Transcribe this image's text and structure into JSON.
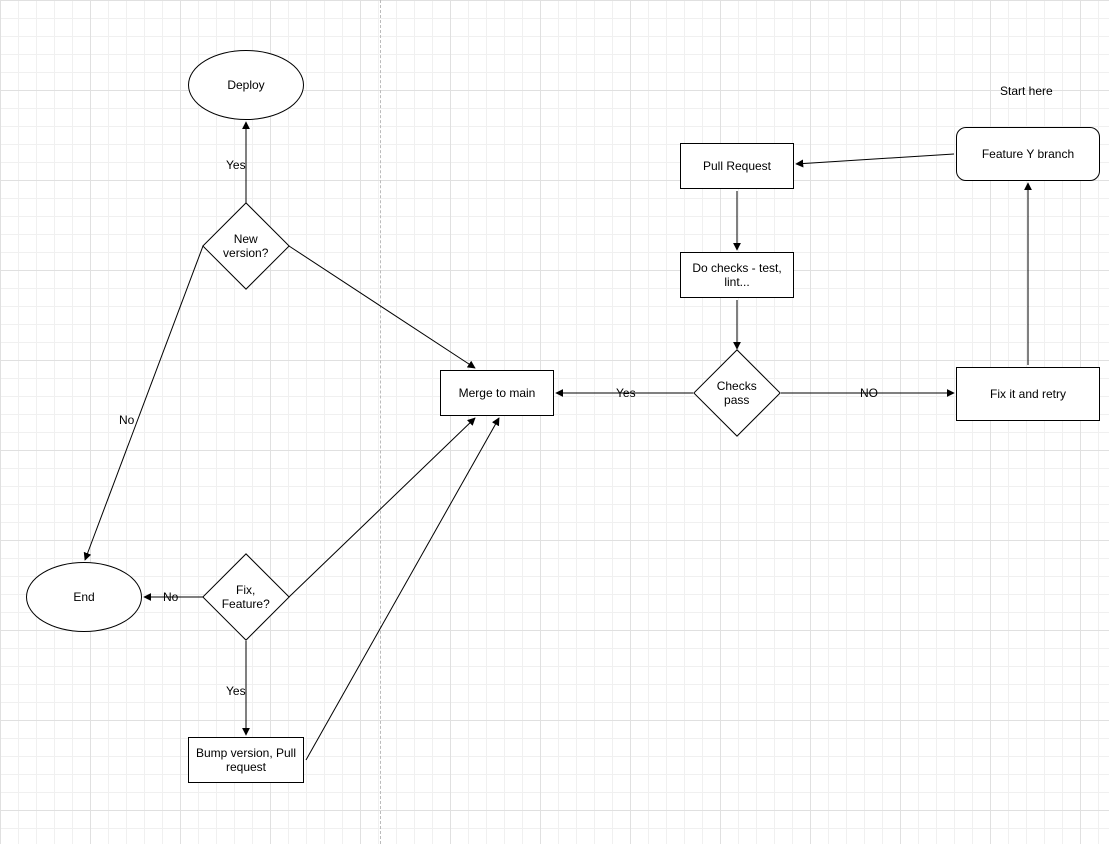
{
  "labels": {
    "start_here": "Start here"
  },
  "nodes": {
    "deploy": "Deploy",
    "new_version": "New version?",
    "end": "End",
    "fix_feature": "Fix, Feature?",
    "bump_version": "Bump version, Pull request",
    "merge_main": "Merge to main",
    "checks_pass": "Checks pass",
    "do_checks": "Do checks - test, lint...",
    "pull_request": "Pull Request",
    "feature_branch": "Feature Y branch",
    "fix_retry": "Fix it and retry"
  },
  "edges": {
    "yes1": "Yes",
    "no1": "No",
    "yes2": "Yes",
    "no2": "No",
    "yes3": "Yes",
    "no3": "NO"
  }
}
